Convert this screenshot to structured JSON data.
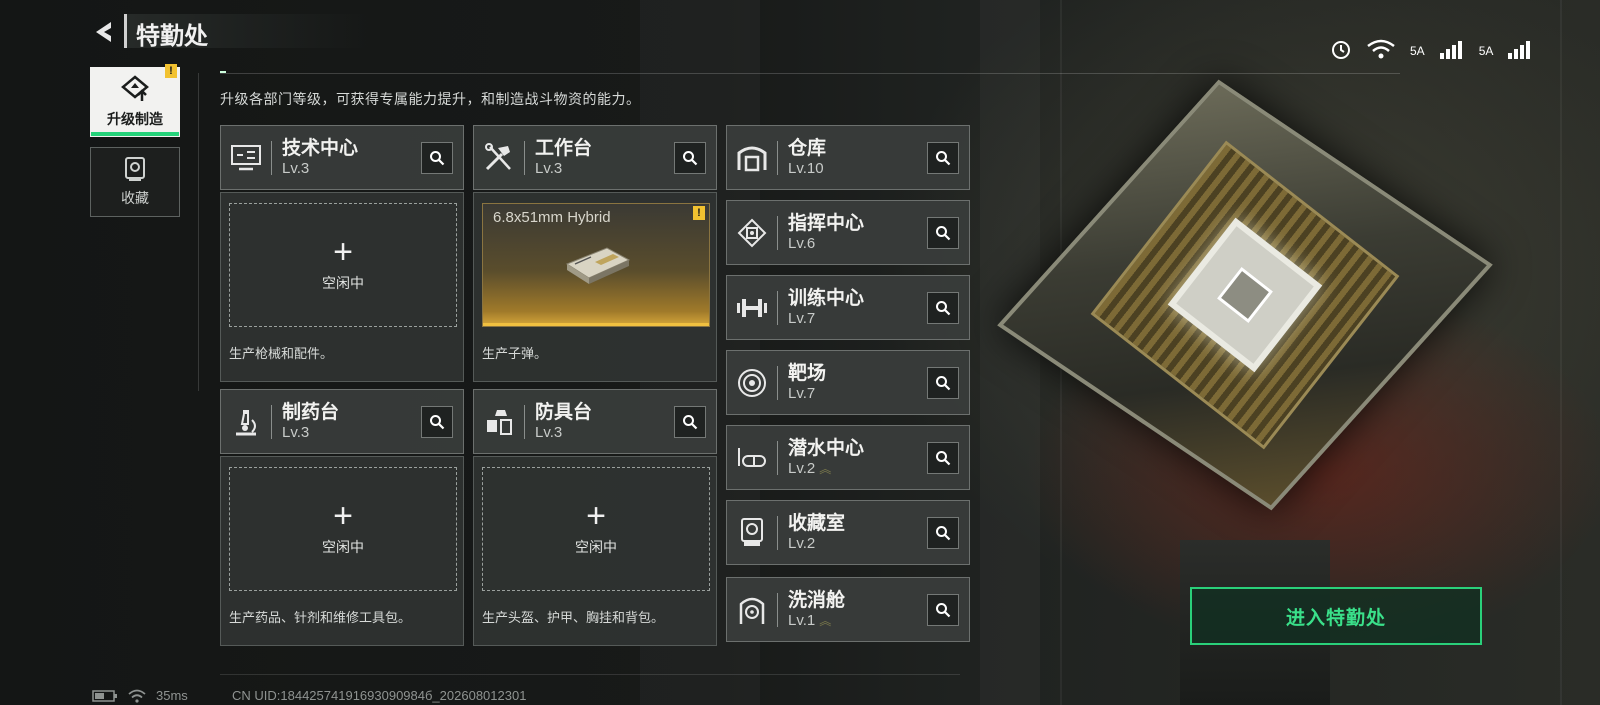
{
  "header": {
    "title": "特勤处"
  },
  "status_bar": {
    "network_a": "5A",
    "network_b": "5A"
  },
  "tabs": [
    {
      "label": "升级制造",
      "active": true,
      "badge": "!"
    },
    {
      "label": "收藏",
      "active": false
    }
  ],
  "intro": "升级各部门等级，可获得专属能力提升，和制造战斗物资的能力。",
  "production": [
    {
      "name": "技术中心",
      "level": "Lv.3",
      "icon": "monitor-icon",
      "slot_state": "空闲中",
      "description": "生产枪械和配件。"
    },
    {
      "name": "工作台",
      "level": "Lv.3",
      "icon": "tools-icon",
      "slot_item": "6.8x51mm Hybrid",
      "slot_badge": "!",
      "description": "生产子弹。"
    },
    {
      "name": "制药台",
      "level": "Lv.3",
      "icon": "microscope-icon",
      "slot_state": "空闲中",
      "description": "生产药品、针剂和维修工具包。"
    },
    {
      "name": "防具台",
      "level": "Lv.3",
      "icon": "armor-icon",
      "slot_state": "空闲中",
      "description": "生产头盔、护甲、胸挂和背包。"
    }
  ],
  "facilities": [
    {
      "name": "仓库",
      "level": "Lv.10",
      "icon": "warehouse-icon"
    },
    {
      "name": "指挥中心",
      "level": "Lv.6",
      "icon": "chip-icon"
    },
    {
      "name": "训练中心",
      "level": "Lv.7",
      "icon": "dumbbell-icon"
    },
    {
      "name": "靶场",
      "level": "Lv.7",
      "icon": "target-icon"
    },
    {
      "name": "潜水中心",
      "level": "Lv.2",
      "icon": "diving-mask-icon",
      "upgradable": true
    },
    {
      "name": "收藏室",
      "level": "Lv.2",
      "icon": "collection-icon"
    },
    {
      "name": "洗消舱",
      "level": "Lv.1",
      "icon": "radiation-icon",
      "upgradable": true
    }
  ],
  "actions": {
    "enter": "进入特勤处"
  },
  "footer": {
    "ping": "35ms",
    "uid": "CN UID:18442574191693090984б_202608012301"
  },
  "colors": {
    "accent_green": "#2ad07a",
    "warning_yellow": "#f2c230"
  }
}
